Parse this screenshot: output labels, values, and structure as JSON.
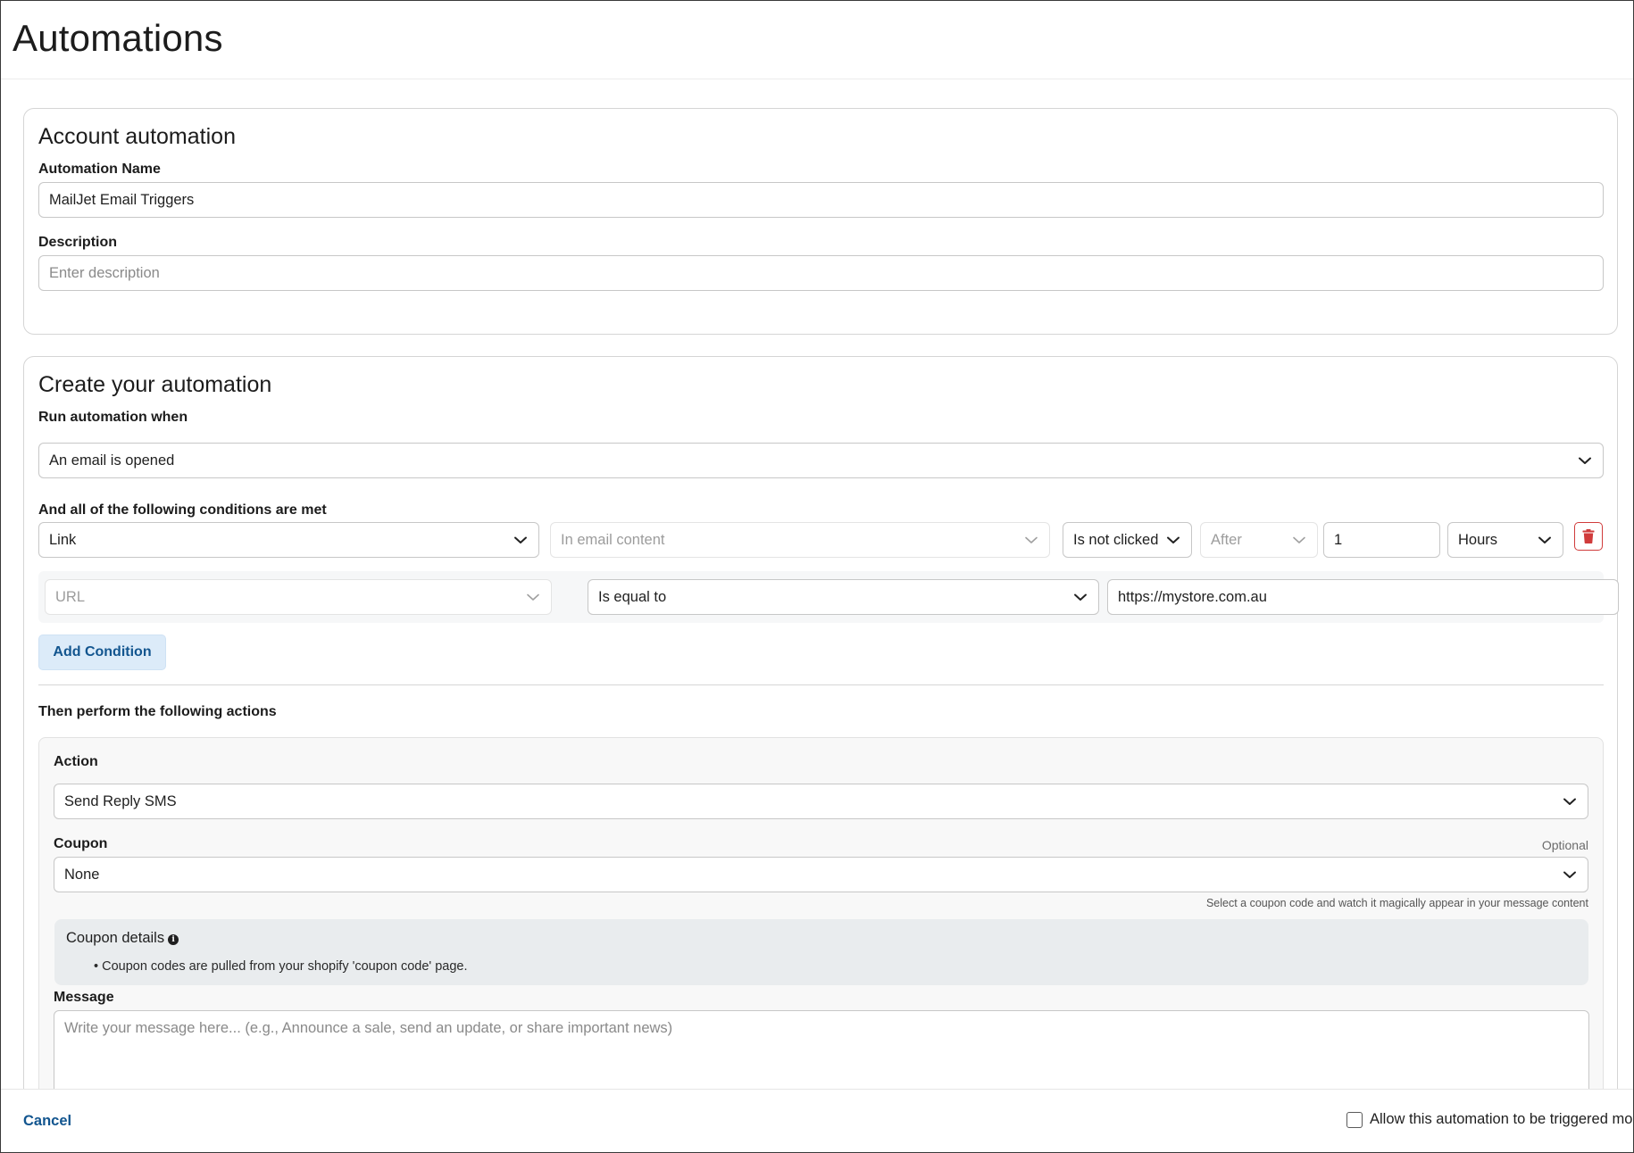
{
  "page": {
    "title": "Automations"
  },
  "account_card": {
    "title": "Account automation",
    "name_label": "Automation Name",
    "name_value": "MailJet Email Triggers",
    "description_label": "Description",
    "description_placeholder": "Enter description"
  },
  "create_card": {
    "title": "Create your automation",
    "trigger_label": "Run automation when",
    "trigger_value": "An email is opened",
    "conditions_label": "And all of the following conditions are met",
    "condition": {
      "field": "Link",
      "source_placeholder": "In email content",
      "operator": "Is not clicked",
      "timing_placeholder": "After",
      "amount": "1",
      "unit": "Hours"
    },
    "sub_condition": {
      "field_placeholder": "URL",
      "operator": "Is equal to",
      "value": "https://mystore.com.au"
    },
    "add_condition_label": "Add Condition",
    "actions_label": "Then perform the following actions",
    "action": {
      "action_label": "Action",
      "action_value": "Send Reply SMS",
      "coupon_label": "Coupon",
      "coupon_optional": "Optional",
      "coupon_value": "None",
      "coupon_hint": "Select a coupon code and watch it magically appear in your message content",
      "coupon_details_title": "Coupon details",
      "coupon_details_bullet": "• Coupon codes are pulled from your shopify 'coupon code' page.",
      "message_label": "Message",
      "message_placeholder": "Write your message here... (e.g., Announce a sale, send an update, or share important news)"
    }
  },
  "footer": {
    "cancel_label": "Cancel",
    "allow_label": "Allow this automation to be triggered mo"
  },
  "icons": {
    "dropdown": "chevron-down-icon",
    "delete": "trash-icon",
    "info": "info-icon"
  },
  "colors": {
    "accent": "#12558f",
    "accent_bg": "#dcebf9",
    "danger": "#d03b3b"
  }
}
